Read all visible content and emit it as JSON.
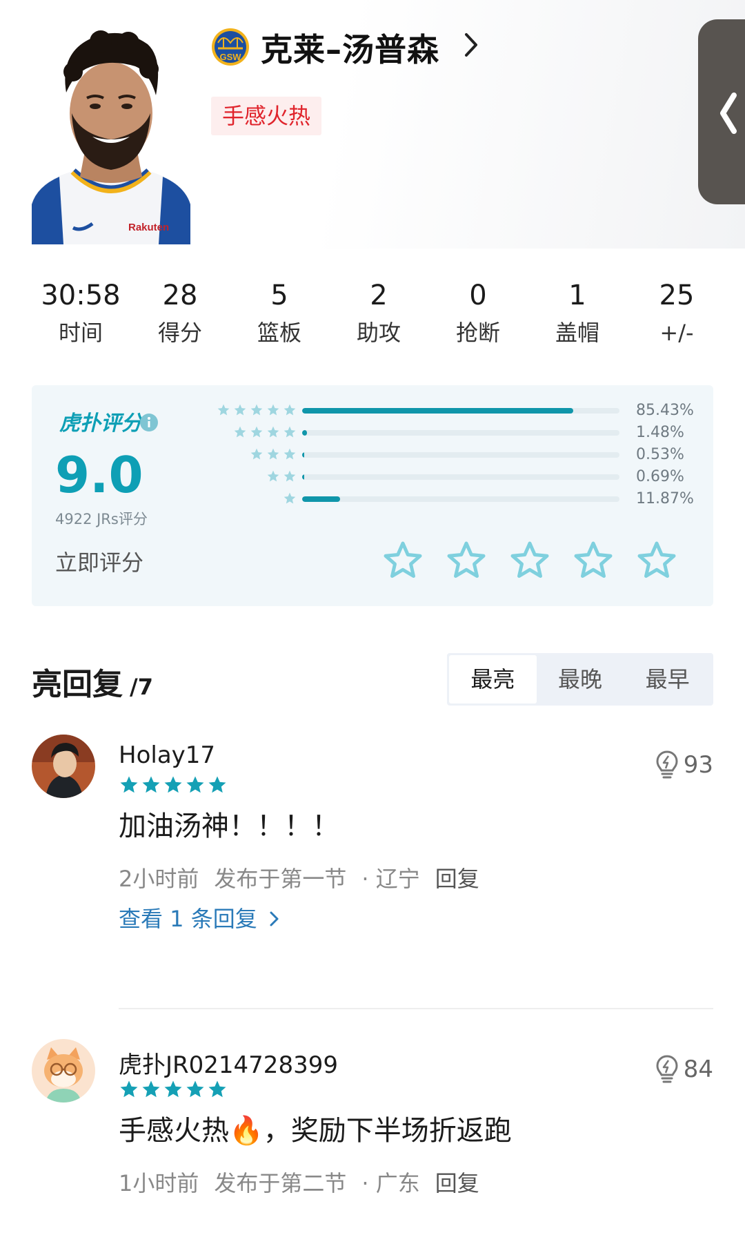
{
  "player": {
    "name": "克莱–汤普森",
    "team_logo_text": "GSW",
    "badge": "手感火热",
    "jersey_sponsor": "Rakuten"
  },
  "stats": [
    {
      "value": "30:58",
      "label": "时间"
    },
    {
      "value": "28",
      "label": "得分"
    },
    {
      "value": "5",
      "label": "篮板"
    },
    {
      "value": "2",
      "label": "助攻"
    },
    {
      "value": "0",
      "label": "抢断"
    },
    {
      "value": "1",
      "label": "盖帽"
    },
    {
      "value": "25",
      "label": "+/-"
    }
  ],
  "rating": {
    "brand": "虎扑评分",
    "brand_mark": "®",
    "score": "9.0",
    "count": "4922 JRs评分",
    "rate_now": "立即评分",
    "distribution": [
      {
        "stars": 5,
        "percent_text": "85.43%",
        "percent": 85.43
      },
      {
        "stars": 4,
        "percent_text": "1.48%",
        "percent": 1.48
      },
      {
        "stars": 3,
        "percent_text": "0.53%",
        "percent": 0.53
      },
      {
        "stars": 2,
        "percent_text": "0.69%",
        "percent": 0.69
      },
      {
        "stars": 1,
        "percent_text": "11.87%",
        "percent": 11.87
      }
    ],
    "rate_star_count": 5
  },
  "replies": {
    "title": "亮回复",
    "count": "/7",
    "sort_tabs": [
      {
        "label": "最亮",
        "active": true
      },
      {
        "label": "最晚",
        "active": false
      },
      {
        "label": "最早",
        "active": false
      }
    ],
    "comments": [
      {
        "username": "Holay17",
        "stars": 5,
        "likes": "93",
        "text": "加油汤神！！！！",
        "time": "2小时前",
        "period": "发布于第一节",
        "location": "· 辽宁",
        "reply": "回复",
        "view_replies": "查看 1 条回复"
      },
      {
        "username": "虎扑JR0214728399",
        "stars": 5,
        "likes": "84",
        "text": "手感火热🔥，奖励下半场折返跑",
        "time": "1小时前",
        "period": "发布于第二节",
        "location": "· 广东",
        "reply": "回复"
      }
    ]
  },
  "colors": {
    "accent": "#0e9fb5",
    "badge_red": "#e0242c",
    "link_blue": "#2a7ab8",
    "card_bg": "#f1f7fa"
  },
  "icons": [
    "team-logo-icon",
    "chevron-right-icon",
    "side-collapse-icon",
    "info-icon",
    "star-icon",
    "star-outline-icon",
    "lightbulb-icon"
  ]
}
